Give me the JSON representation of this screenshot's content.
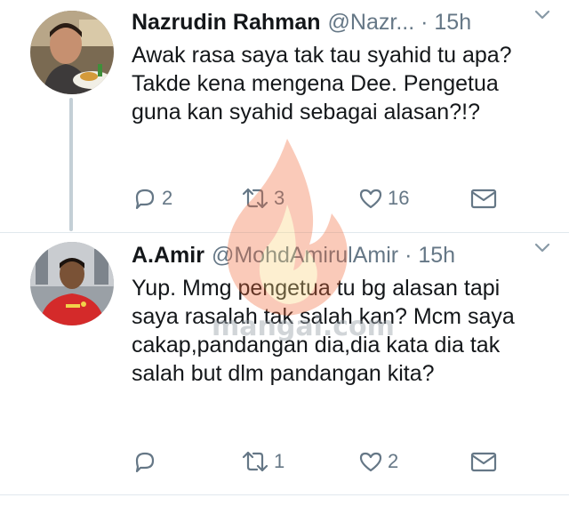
{
  "tweets": [
    {
      "name": "Nazrudin Rahman",
      "handle": "@Nazr...",
      "time": "· 15h",
      "text": "Awak rasa saya tak tau syahid tu apa? Takde kena mengena Dee. Pengetua guna kan syahid sebagai alasan?!?",
      "reply_count": "2",
      "retweet_count": "3",
      "like_count": "16"
    },
    {
      "name": "A.Amir",
      "handle": "@MohdAmirulAmir",
      "time": "· 15h",
      "text": "Yup. Mmg pengetua tu bg alasan tapi saya rasalah tak salah kan? Mcm saya cakap,pandangan dia,dia kata dia tak salah but dlm pandangan kita?",
      "reply_count": "",
      "retweet_count": "1",
      "like_count": "2"
    }
  ],
  "watermark": {
    "text": "mangai.com"
  },
  "colors": {
    "text": "#14171a",
    "secondary": "#657786",
    "thread_line": "#c4cfd6",
    "divider": "#e1e8ed",
    "watermark_flame": "#f26b3a"
  }
}
